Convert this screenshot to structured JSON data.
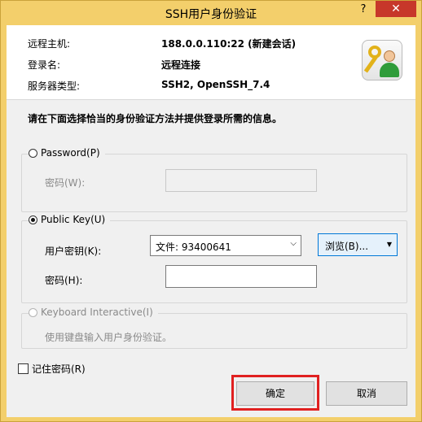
{
  "window": {
    "title": "SSH用户身份验证",
    "help_label": "?",
    "close_label": "✕"
  },
  "info": {
    "remote_host_label": "远程主机:",
    "remote_host_value": "188.0.0.110:22 (新建会话)",
    "login_name_label": "登录名:",
    "login_name_value": "远程连接",
    "server_type_label": "服务器类型:",
    "server_type_value": "SSH2, OpenSSH_7.4"
  },
  "instruction": "请在下面选择恰当的身份验证方法并提供登录所需的信息。",
  "password_group": {
    "radio_label": "Password(P)",
    "selected": false,
    "password_label": "密码(W):",
    "password_value": ""
  },
  "publickey_group": {
    "radio_label": "Public Key(U)",
    "selected": true,
    "user_key_label": "用户密钥(K):",
    "user_key_value": "文件: 93400641",
    "browse_label": "浏览(B)...",
    "passphrase_label": "密码(H):",
    "passphrase_value": ""
  },
  "keyboard_group": {
    "radio_label": "Keyboard Interactive(I)",
    "selected": false,
    "description": "使用键盘输入用户身份验证。"
  },
  "remember_password": {
    "label": "记住密码(R)",
    "checked": false
  },
  "buttons": {
    "ok": "确定",
    "cancel": "取消"
  },
  "icons": {
    "help": "question-mark-icon",
    "close": "close-icon",
    "app": "key-user-icon",
    "dropdown": "chevron-down-icon",
    "browse_menu": "triangle-down-icon"
  },
  "colors": {
    "titlebar": "#f3cf6b",
    "close_button": "#c7372a",
    "highlight": "#e02020",
    "browse_border": "#0078d7"
  }
}
